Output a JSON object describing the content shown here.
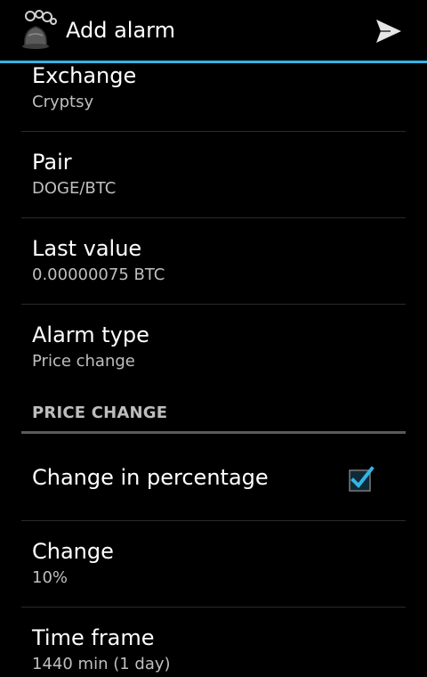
{
  "colors": {
    "accent": "#33b5e5",
    "background": "#000000",
    "title_text": "#ffffff",
    "summary_text": "#bfbfbf"
  },
  "action_bar": {
    "title": "Add alarm",
    "app_icon": "bell-with-bubbles-icon",
    "send_icon": "send-icon"
  },
  "preferences": [
    {
      "title": "Exchange",
      "summary": "Cryptsy"
    },
    {
      "title": "Pair",
      "summary": "DOGE/BTC"
    },
    {
      "title": "Last value",
      "summary": "0.00000075 BTC"
    },
    {
      "title": "Alarm type",
      "summary": "Price change"
    }
  ],
  "price_change": {
    "header": "PRICE CHANGE",
    "change_in_percentage": {
      "title": "Change in percentage",
      "checked": true
    },
    "change": {
      "title": "Change",
      "summary": "10%"
    },
    "time_frame": {
      "title": "Time frame",
      "summary": "1440 min (1 day)"
    }
  }
}
